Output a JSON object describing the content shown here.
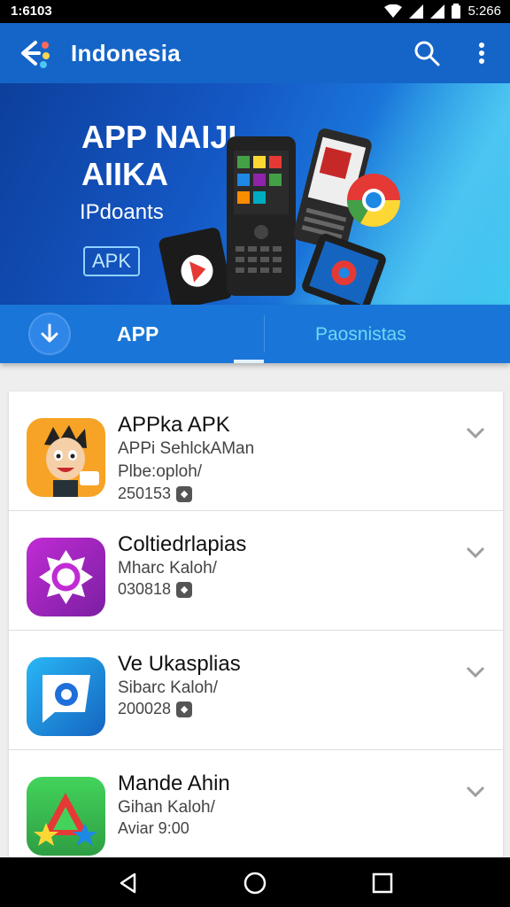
{
  "status": {
    "time": "1:6103",
    "right_time": "5:266",
    "icons": [
      "wifi-icon",
      "signal-icon",
      "signal-icon",
      "battery-icon"
    ]
  },
  "appbar": {
    "title": "Indonesia",
    "back_icon": "back-arrow-icon",
    "search_icon": "search-icon",
    "more_icon": "more-vert-icon"
  },
  "banner": {
    "line1": "APP NAIJI",
    "line2": "AIIKA",
    "line3": "IPdoants",
    "chip": "APK"
  },
  "tabs": {
    "download_icon": "download-icon",
    "tab1": "APP",
    "tab2": "Paosnistas"
  },
  "apps": [
    {
      "name": "APPka APK",
      "line2": "APPi SehlckAMan",
      "line3": "Plbe:oploh/",
      "meta": "250153",
      "icon": "cartoon-face-icon"
    },
    {
      "name": "Coltiedrlapias",
      "line2": "Mharc Kaloh/",
      "meta": "030818",
      "icon": "purple-gear-icon"
    },
    {
      "name": "Ve Ukasplias",
      "line2": "Sibarc Kaloh/",
      "meta": "200028",
      "icon": "blue-chat-icon"
    },
    {
      "name": "Mande Ahin",
      "line2": "Gihan Kaloh/",
      "meta": "Aviar 9:00",
      "icon": "star-triangle-icon"
    }
  ],
  "colors": {
    "primary": "#1565c8",
    "tab_bar": "#1976d8",
    "accent_tab": "#6fd8f5"
  }
}
